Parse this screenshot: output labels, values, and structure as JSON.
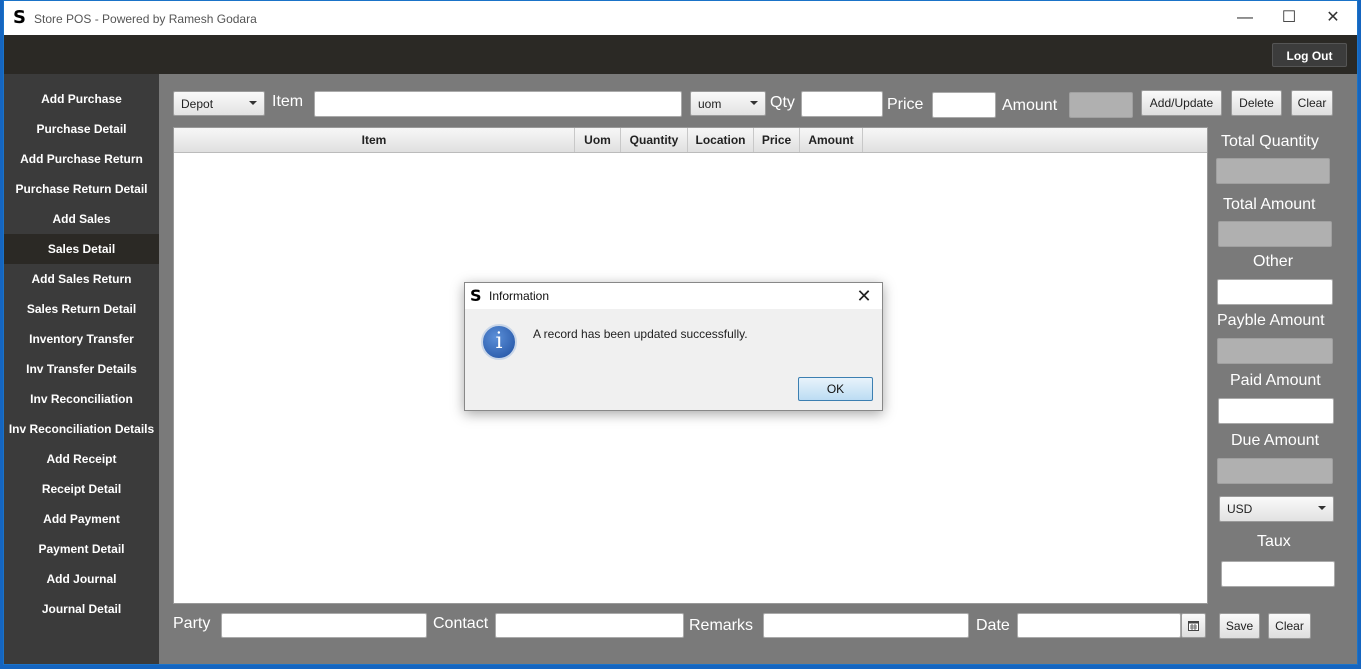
{
  "window": {
    "title": "Store POS - Powered by Ramesh Godara",
    "logo": "S",
    "controls": {
      "minimize": "—",
      "maximize": "☐",
      "close": "✕"
    }
  },
  "topbar": {
    "logout_label": "Log Out"
  },
  "sidebar": {
    "items": [
      {
        "label": "Add Purchase"
      },
      {
        "label": "Purchase Detail"
      },
      {
        "label": "Add Purchase Return"
      },
      {
        "label": "Purchase Return Detail"
      },
      {
        "label": "Add Sales"
      },
      {
        "label": "Sales Detail",
        "active": true
      },
      {
        "label": "Add Sales Return"
      },
      {
        "label": "Sales Return Detail"
      },
      {
        "label": "Inventory Transfer"
      },
      {
        "label": "Inv Transfer Details"
      },
      {
        "label": "Inv Reconciliation"
      },
      {
        "label": "Inv Reconciliation Details"
      },
      {
        "label": "Add Receipt"
      },
      {
        "label": "Receipt Detail"
      },
      {
        "label": "Add Payment"
      },
      {
        "label": "Payment Detail"
      },
      {
        "label": "Add Journal"
      },
      {
        "label": "Journal Detail"
      }
    ]
  },
  "entry_row": {
    "location_selected": "Depot",
    "item_label": "Item",
    "item_value": "",
    "uom_selected": "uom",
    "qty_label": "Qty",
    "qty_value": "",
    "price_label": "Price",
    "price_value": "",
    "amount_label": "Amount",
    "add_update_label": "Add/Update",
    "delete_label": "Delete",
    "clear_label": "Clear"
  },
  "table": {
    "columns": [
      "Item",
      "Uom",
      "Quantity",
      "Location",
      "Price",
      "Amount"
    ],
    "rows": []
  },
  "totals": {
    "total_quantity_label": "Total Quantity",
    "total_amount_label": "Total Amount",
    "other_label": "Other",
    "payable_amount_label": "Payble Amount",
    "paid_amount_label": "Paid Amount",
    "due_amount_label": "Due Amount",
    "currency_selected": "USD",
    "taux_label": "Taux"
  },
  "footer": {
    "party_label": "Party",
    "contact_label": "Contact",
    "remarks_label": "Remarks",
    "date_label": "Date",
    "save_label": "Save",
    "clear_label": "Clear"
  },
  "dialog": {
    "logo": "S",
    "title": "Information",
    "icon_glyph": "i",
    "message": "A record has been updated successfully.",
    "ok_label": "OK"
  },
  "icons": {
    "calendar": "calendar-icon",
    "info": "info-icon",
    "close": "close-icon"
  }
}
